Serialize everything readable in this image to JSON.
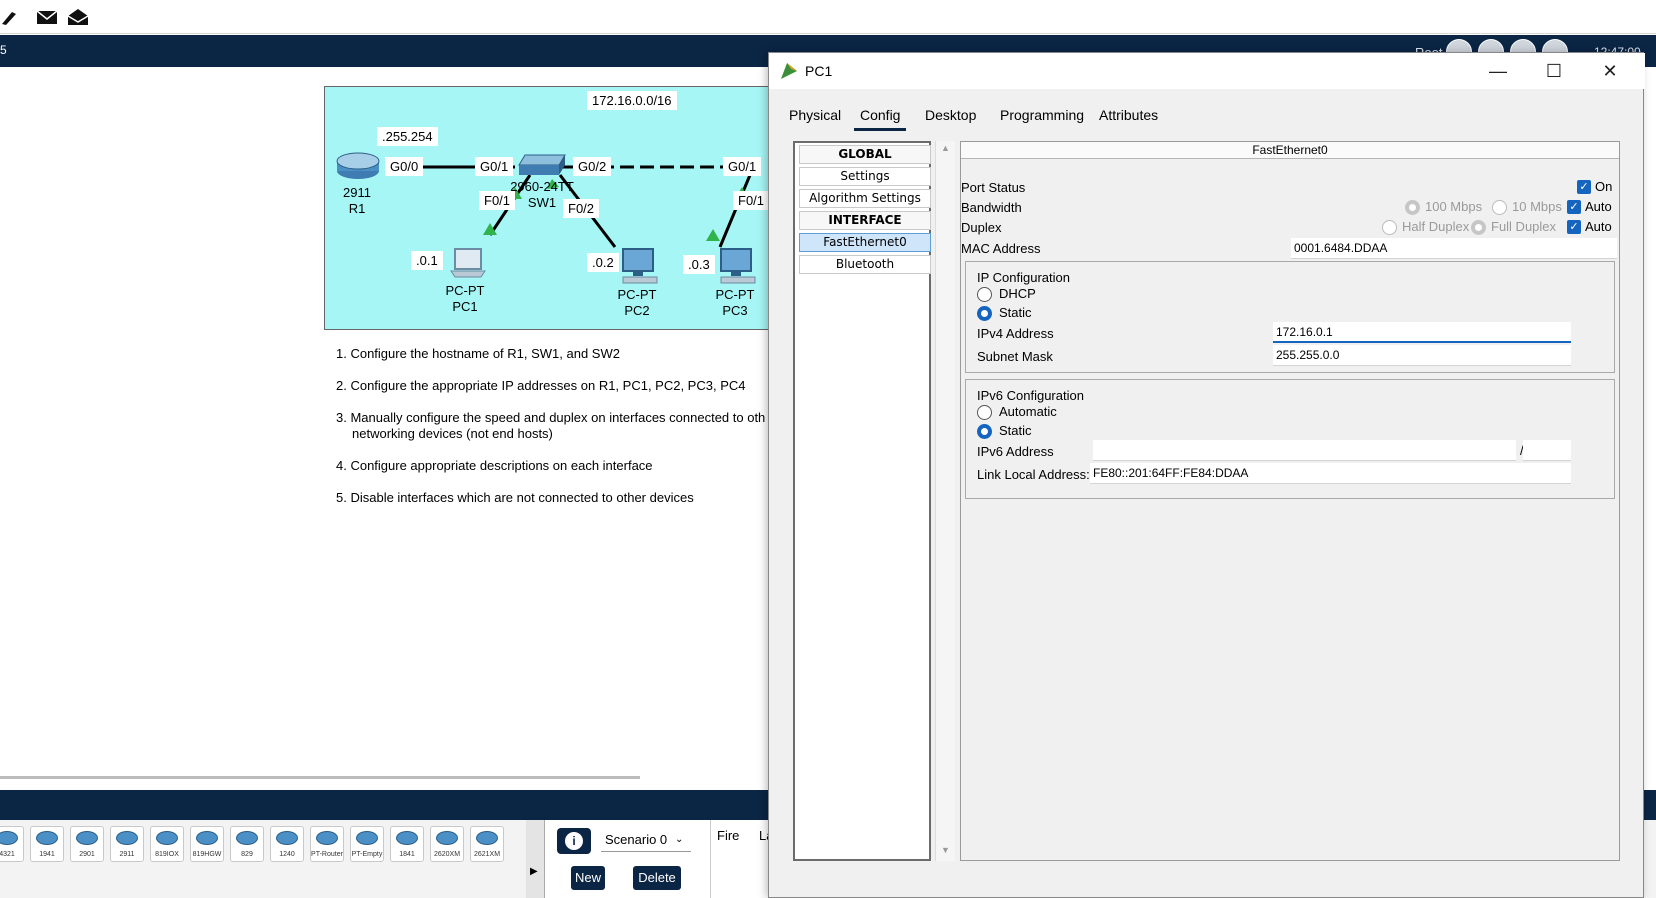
{
  "toolbar": {
    "icons": [
      "pen-icon",
      "mail-icon",
      "mail-open-icon"
    ]
  },
  "topbar": {
    "left_text": "5",
    "root_label": "Root",
    "time": "12:47:00"
  },
  "topology": {
    "network_label": "172.16.0.0/16",
    "router": {
      "ip_suffix": ".255.254",
      "model": "2911",
      "name": "R1",
      "port": "G0/0"
    },
    "switch": {
      "model": "2960-24TT",
      "name": "SW1",
      "port_left": "G0/1",
      "port_right": "G0/2",
      "port_pc1": "F0/1",
      "port_pc2": "F0/2"
    },
    "switch2": {
      "port_left": "G0/1",
      "port_pc3": "F0/1"
    },
    "pcs": [
      {
        "ip_suffix": ".0.1",
        "type": "PC-PT",
        "name": "PC1"
      },
      {
        "ip_suffix": ".0.2",
        "type": "PC-PT",
        "name": "PC2"
      },
      {
        "ip_suffix": ".0.3",
        "type": "PC-PT",
        "name": "PC3"
      }
    ]
  },
  "tasks": [
    "1. Configure the hostname of R1, SW1, and SW2",
    "2. Configure the appropriate IP addresses on R1, PC1, PC2, PC3, PC4",
    "3. Manually configure the speed and duplex on interfaces connected to oth networking devices (not end hosts)",
    "4. Configure appropriate descriptions on each interface",
    "5. Disable interfaces which are not connected to other devices"
  ],
  "device_palette": [
    "4321",
    "1941",
    "2901",
    "2911",
    "819IOX",
    "819HGW",
    "829",
    "1240",
    "PT-Router",
    "PT-Empty",
    "1841",
    "2620XM",
    "2621XM"
  ],
  "scenario": {
    "select": "Scenario 0",
    "new_label": "New",
    "delete_label": "Delete",
    "fire_col": "Fire",
    "last_col": "La"
  },
  "window": {
    "title": "PC1",
    "tabs": [
      "Physical",
      "Config",
      "Desktop",
      "Programming",
      "Attributes"
    ],
    "active_tab": "Config",
    "nav": {
      "global": "GLOBAL",
      "settings": "Settings",
      "algorithm": "Algorithm Settings",
      "interface": "INTERFACE",
      "fastethernet": "FastEthernet0",
      "bluetooth": "Bluetooth"
    },
    "panel": {
      "header": "FastEthernet0",
      "port_status": {
        "label": "Port Status",
        "on_label": "On",
        "checked": true
      },
      "bandwidth": {
        "label": "Bandwidth",
        "opt1": "100 Mbps",
        "opt2": "10 Mbps",
        "auto": "Auto"
      },
      "duplex": {
        "label": "Duplex",
        "opt1": "Half Duplex",
        "opt2": "Full Duplex",
        "auto": "Auto"
      },
      "mac": {
        "label": "MAC Address",
        "value": "0001.6484.DDAA"
      },
      "ipv4": {
        "group_label": "IP Configuration",
        "dhcp": "DHCP",
        "static": "Static",
        "selected": "Static",
        "address_label": "IPv4 Address",
        "address_value": "172.16.0.1",
        "mask_label": "Subnet Mask",
        "mask_value": "255.255.0.0"
      },
      "ipv6": {
        "group_label": "IPv6 Configuration",
        "automatic": "Automatic",
        "static": "Static",
        "selected": "Static",
        "address_label": "IPv6 Address",
        "address_value": "",
        "prefix_sep": "/",
        "prefix_value": "",
        "link_local_label": "Link Local Address:",
        "link_local_value": "FE80::201:64FF:FE84:DDAA"
      }
    }
  },
  "colors": {
    "navy": "#0b2545",
    "canvas": "#a7f6f6",
    "accent": "#1565c0"
  }
}
